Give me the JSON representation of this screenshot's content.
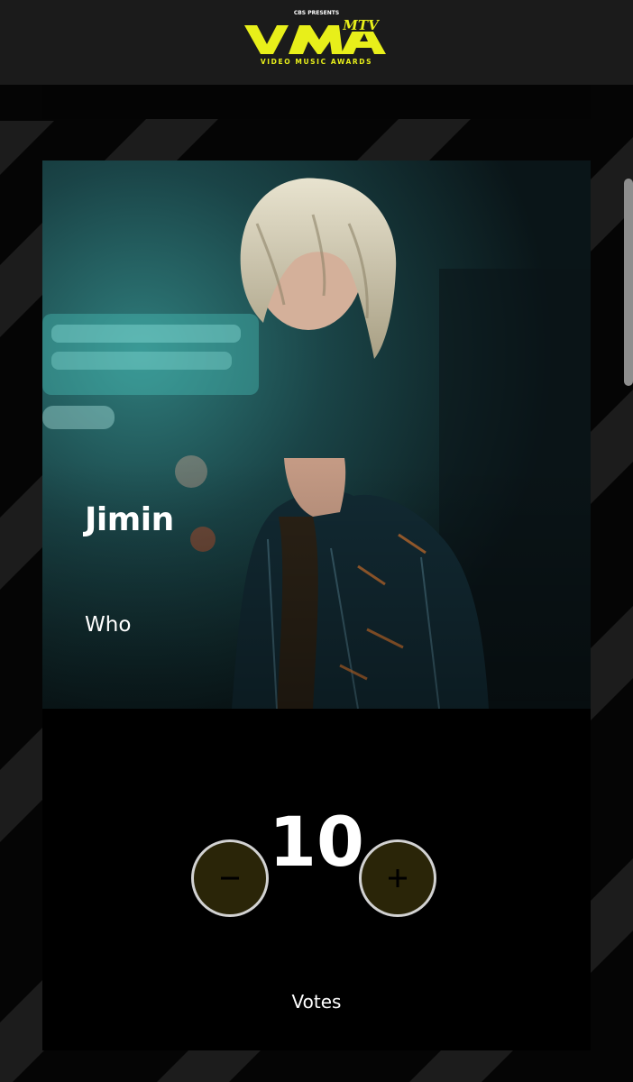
{
  "header": {
    "logo_presenter": "CBS PRESENTS",
    "logo_wordmark": "VMA",
    "logo_tagline": "VIDEO MUSIC AWARDS",
    "logo_channel": "MTV"
  },
  "nominee": {
    "artist": "Jimin",
    "song": "Who"
  },
  "voting": {
    "count": "10",
    "label": "Votes",
    "decrement_icon": "minus-icon",
    "increment_icon": "plus-icon"
  },
  "colors": {
    "brand_yellow": "#e8ef1a",
    "button_fill": "#2a2508",
    "button_border": "#d2d2d2",
    "stripe": "#1c1c1c",
    "background": "#050505"
  }
}
